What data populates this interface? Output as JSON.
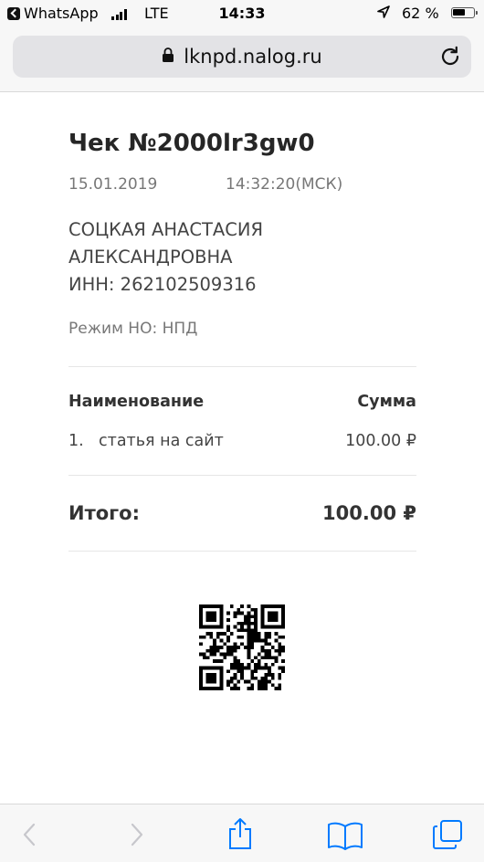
{
  "status_bar": {
    "back_app": "WhatsApp",
    "network": "LTE",
    "time": "14:33",
    "battery_percent": "62 %",
    "battery_level": 0.62
  },
  "address_bar": {
    "url": "lknpd.nalog.ru"
  },
  "receipt": {
    "title": "Чек №2000lr3gw0",
    "date": "15.01.2019",
    "time": "14:32:20(МСК)",
    "seller_name": "СОЦКАЯ АНАСТАСИЯ АЛЕКСАНДРОВНА",
    "seller_inn": "ИНН: 262102509316",
    "tax_mode": "Режим НО: НПД",
    "columns": {
      "name": "Наименование",
      "sum": "Сумма"
    },
    "items": [
      {
        "num": "1.",
        "name": "статья на сайт",
        "sum": "100.00 ₽"
      }
    ],
    "total_label": "Итого:",
    "total_value": "100.00 ₽"
  },
  "icons": {
    "lock": "lock-icon",
    "reload": "reload-icon",
    "back": "chevron-left-icon",
    "forward": "chevron-right-icon",
    "share": "share-icon",
    "bookmarks": "book-icon",
    "tabs": "tabs-icon"
  },
  "colors": {
    "accent": "#007aff",
    "disabled": "#c7c7cc"
  }
}
